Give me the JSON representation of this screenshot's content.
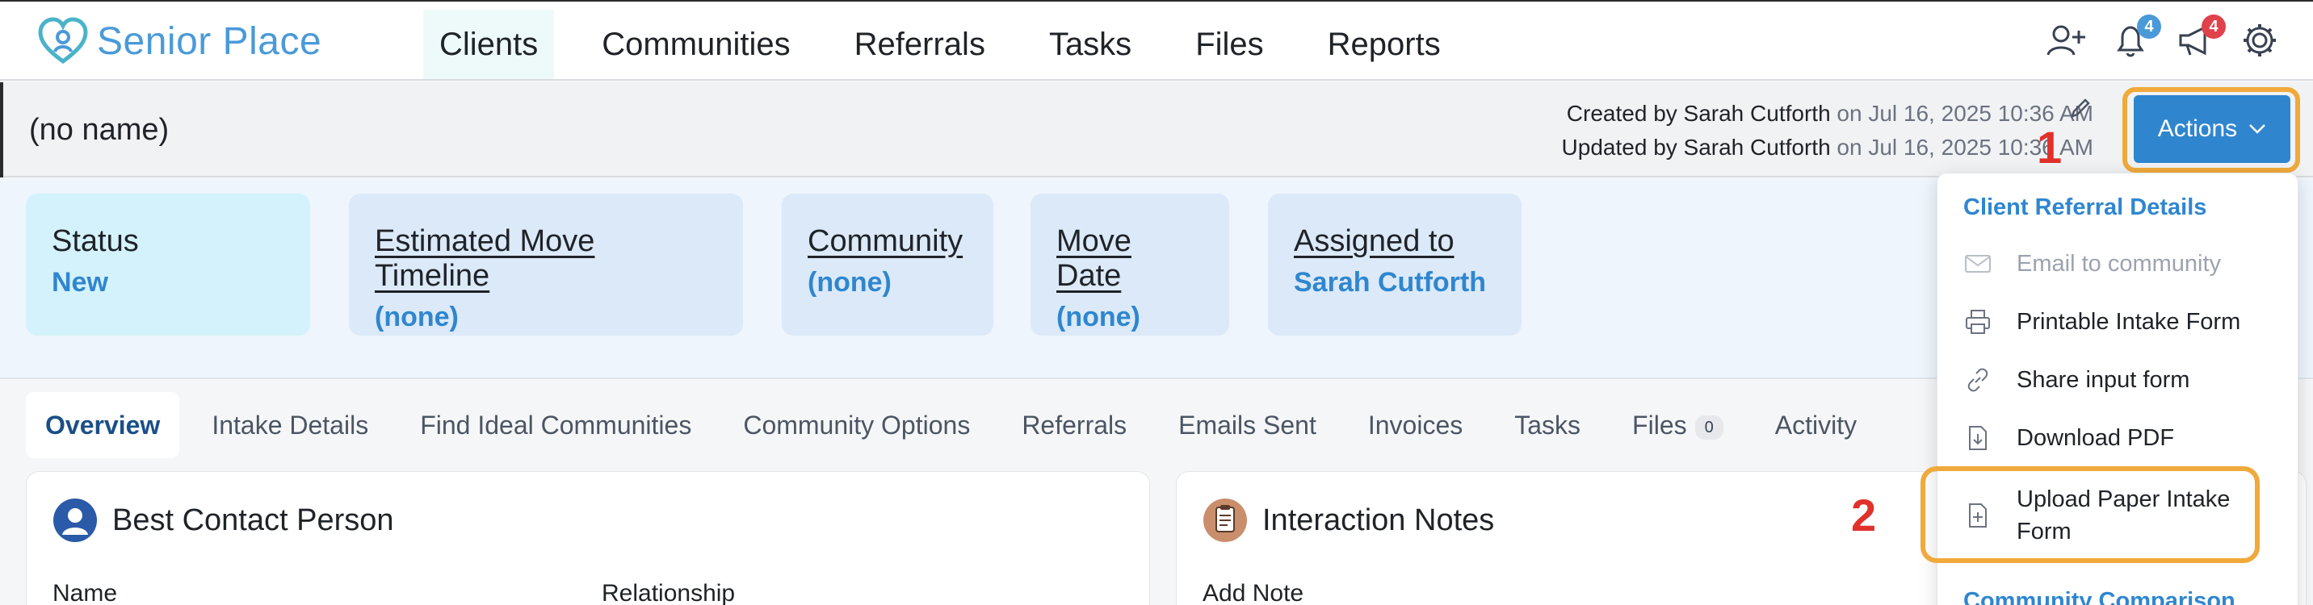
{
  "app": {
    "name": "Senior Place"
  },
  "nav": {
    "items": [
      {
        "label": "Clients",
        "active": true
      },
      {
        "label": "Communities"
      },
      {
        "label": "Referrals"
      },
      {
        "label": "Tasks"
      },
      {
        "label": "Files"
      },
      {
        "label": "Reports"
      }
    ],
    "badges": {
      "notifications": "4",
      "announcements": "4"
    }
  },
  "header": {
    "client_name": "(no name)",
    "created_by": "Created by Sarah Cutforth",
    "created_on": " on Jul 16, 2025 10:36 AM",
    "updated_by": "Updated by Sarah Cutforth",
    "updated_on": " on Jul 16, 2025 10:36 AM",
    "actions_label": "Actions"
  },
  "annotations": {
    "step1": "1",
    "step2": "2"
  },
  "status_cards": [
    {
      "title": "Status",
      "value": "New"
    },
    {
      "title": "Estimated Move Timeline",
      "value": "(none)"
    },
    {
      "title": "Community",
      "value": "(none)"
    },
    {
      "title": "Move Date",
      "value": "(none)"
    },
    {
      "title": "Assigned to",
      "value": "Sarah Cutforth"
    }
  ],
  "tabs": [
    {
      "label": "Overview",
      "active": true
    },
    {
      "label": "Intake Details"
    },
    {
      "label": "Find Ideal Communities"
    },
    {
      "label": "Community Options"
    },
    {
      "label": "Referrals"
    },
    {
      "label": "Emails Sent"
    },
    {
      "label": "Invoices"
    },
    {
      "label": "Tasks"
    },
    {
      "label": "Files",
      "count": "0"
    },
    {
      "label": "Activity"
    }
  ],
  "panels": {
    "contact": {
      "title": "Best Contact Person",
      "col1": "Name",
      "col2": "Relationship"
    },
    "notes": {
      "title": "Interaction Notes",
      "add_note": "Add Note"
    }
  },
  "dropdown": {
    "header": "Client Referral Details",
    "items": [
      {
        "label": "Email to community",
        "icon": "envelope-icon",
        "disabled": true
      },
      {
        "label": "Printable Intake Form",
        "icon": "printer-icon"
      },
      {
        "label": "Share input form",
        "icon": "link-icon"
      },
      {
        "label": "Download PDF",
        "icon": "download-icon"
      },
      {
        "label": "Upload Paper Intake\nForm",
        "icon": "file-plus-icon"
      }
    ],
    "footer": "Community Comparison"
  },
  "colors": {
    "accent": "#2f86cf",
    "highlight": "#f0a93b",
    "step_marker": "#e0312b"
  }
}
